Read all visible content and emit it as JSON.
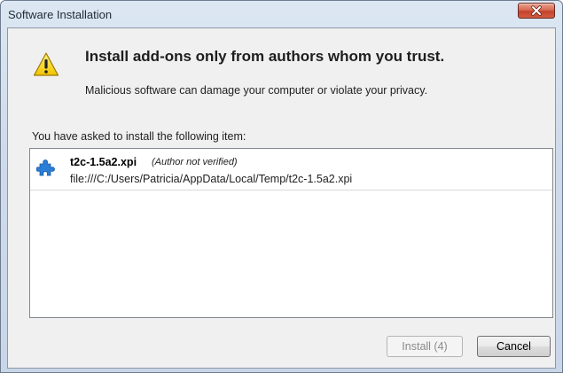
{
  "window": {
    "title": "Software Installation"
  },
  "warning": {
    "headline": "Install add-ons only from authors whom you trust.",
    "subline": "Malicious software can damage your computer or violate your privacy."
  },
  "install_list": {
    "caption": "You have asked to install the following item:",
    "items": [
      {
        "name": "t2c-1.5a2.xpi",
        "note": "(Author not verified)",
        "path": "file:///C:/Users/Patricia/AppData/Local/Temp/t2c-1.5a2.xpi"
      }
    ]
  },
  "buttons": {
    "install_label": "Install (4)",
    "cancel_label": "Cancel"
  }
}
